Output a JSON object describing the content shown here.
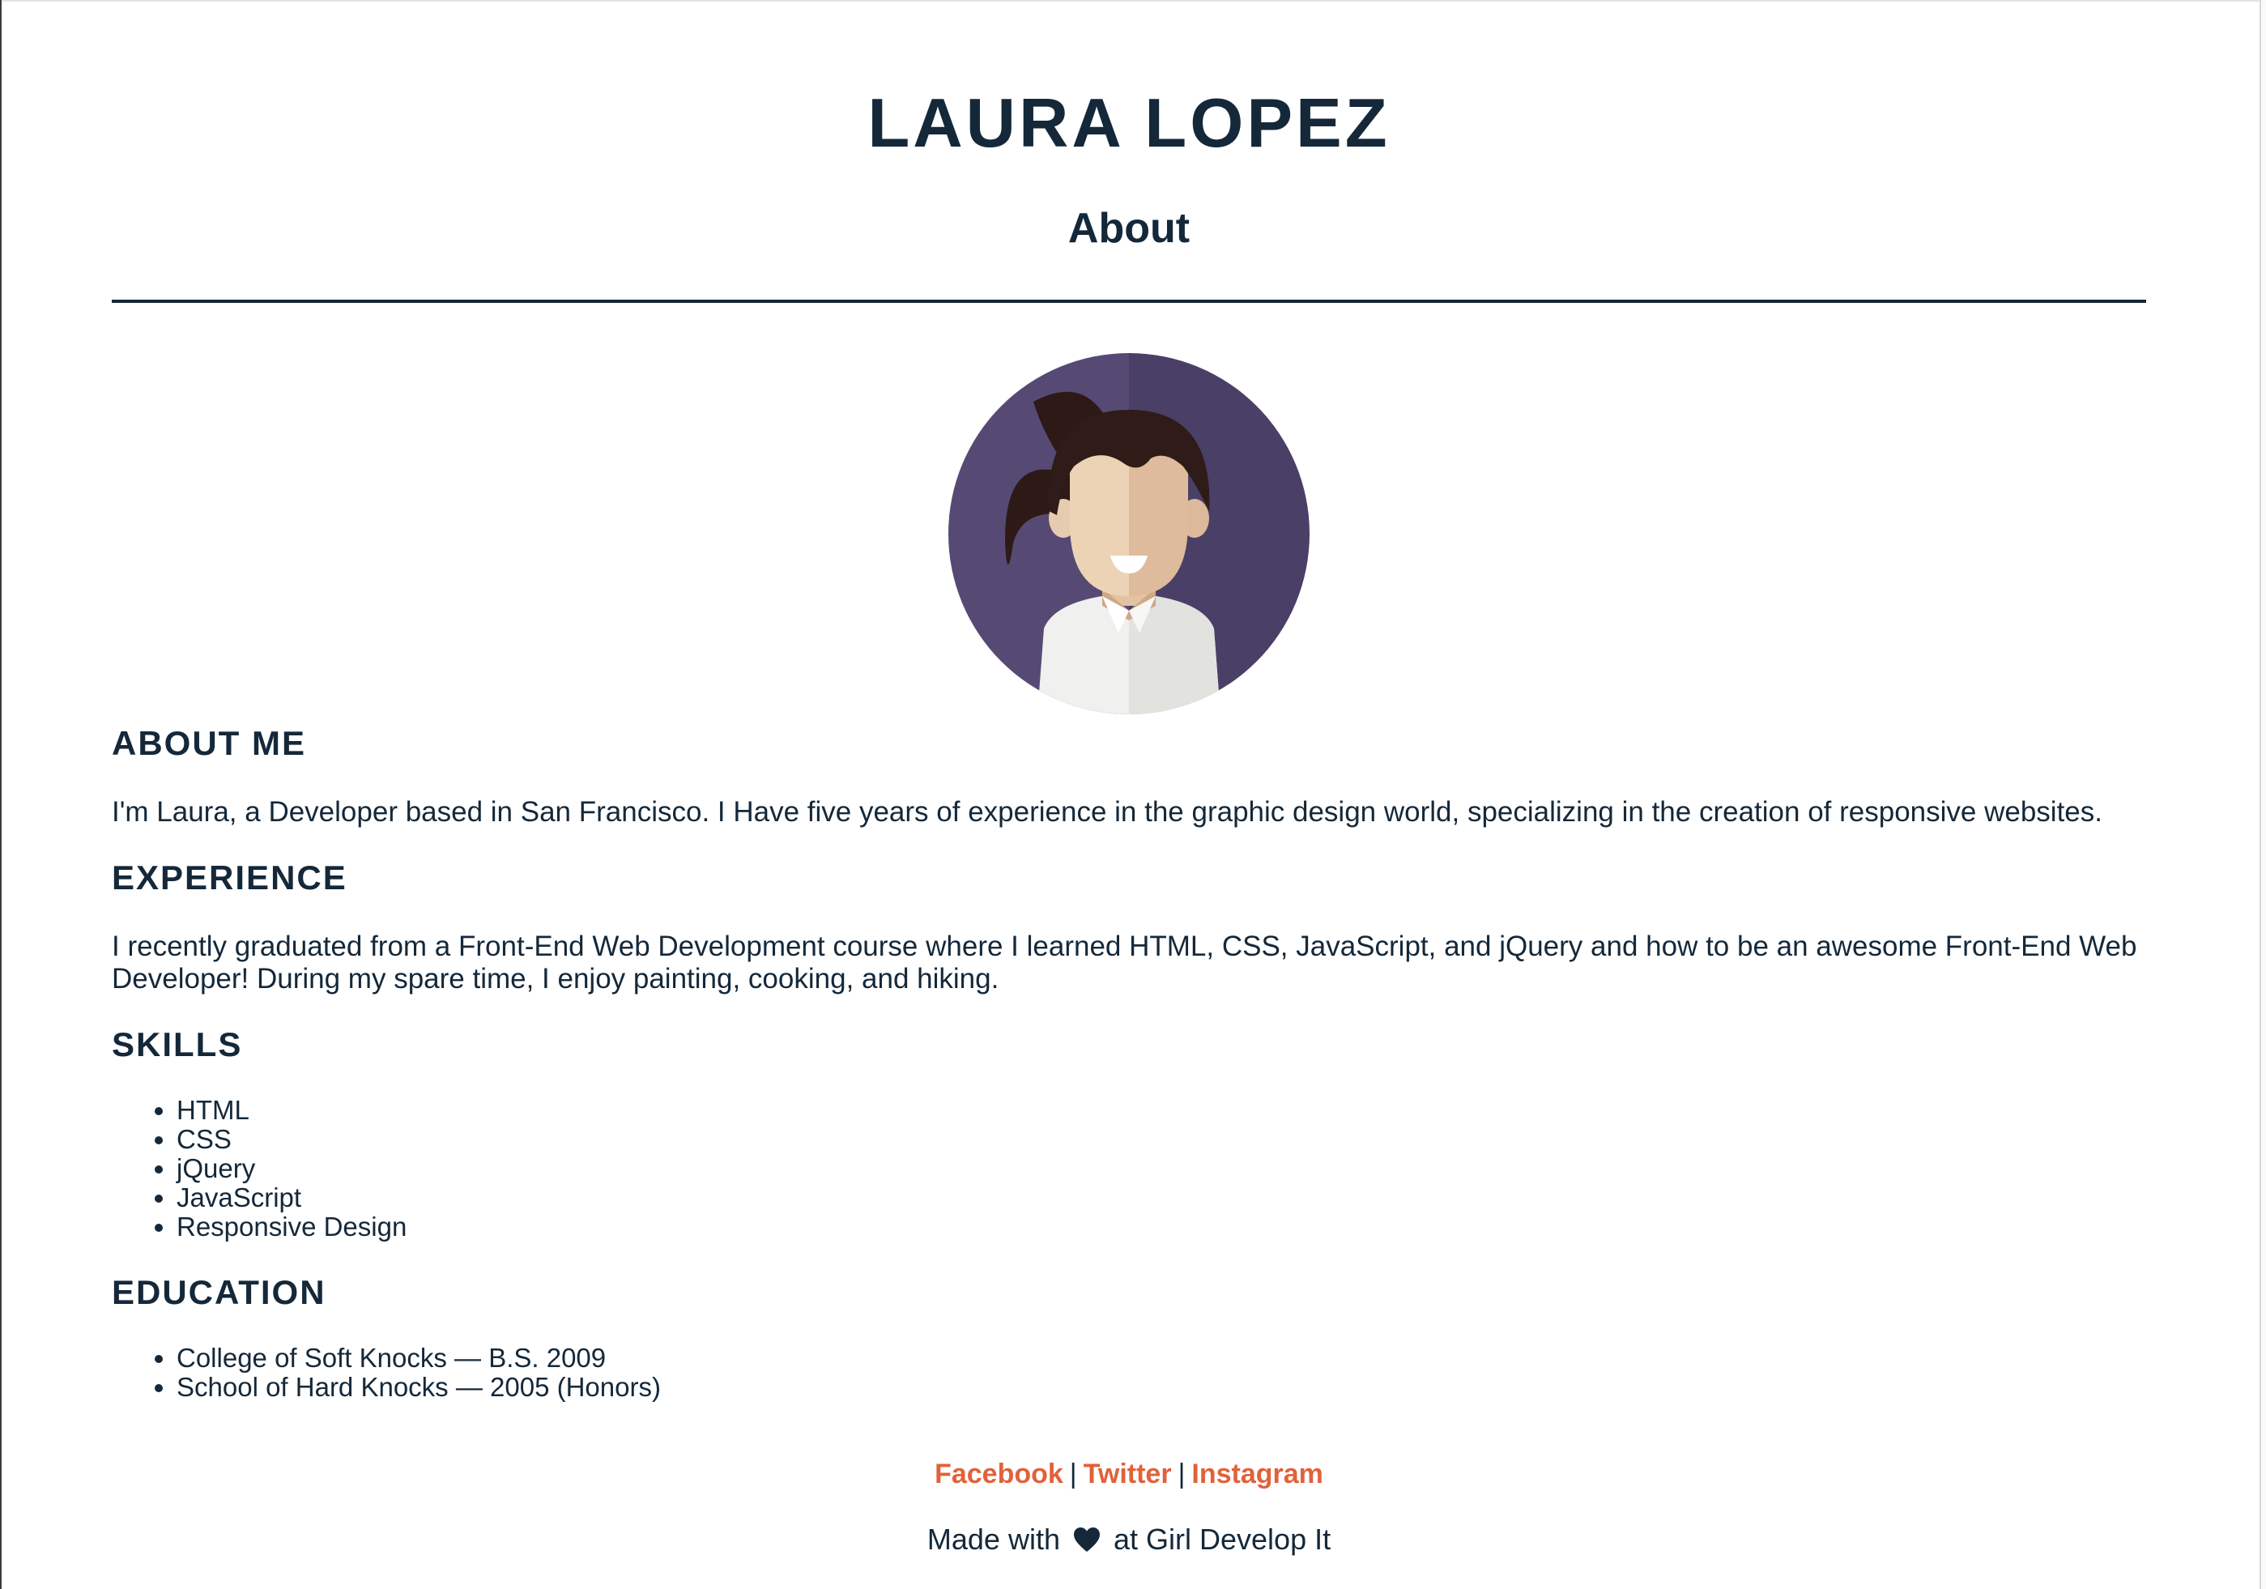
{
  "header": {
    "title": "LAURA LOPEZ",
    "subtitle": "About"
  },
  "sections": {
    "about": {
      "heading": "ABOUT ME",
      "text": "I'm Laura, a Developer based in San Francisco. I Have five years of experience in the graphic design world, specializing in the creation of responsive websites."
    },
    "experience": {
      "heading": "EXPERIENCE",
      "text_line1": "I recently graduated from a Front-End Web Development course where I learned HTML, CSS, JavaScript, and jQuery and how to be an awesome Front-End Web",
      "text_line2": "Developer! During my spare time, I enjoy painting, cooking, and hiking."
    },
    "skills": {
      "heading": "SKILLS",
      "items": [
        "HTML",
        "CSS",
        "jQuery",
        "JavaScript",
        "Responsive Design"
      ]
    },
    "education": {
      "heading": "EDUCATION",
      "items": [
        "College of Soft Knocks — B.S. 2009",
        "School of Hard Knocks — 2005 (Honors)"
      ]
    }
  },
  "footer": {
    "links": [
      "Facebook",
      "Twitter",
      "Instagram"
    ],
    "separator": "|",
    "made_with_prefix": "Made with",
    "made_with_suffix": "at Girl Develop It"
  },
  "icons": {
    "avatar": "woman-avatar-icon",
    "heart": "heart-icon"
  },
  "colors": {
    "text": "#14283a",
    "link": "#e0623a",
    "avatar_bg": "#4f456f"
  }
}
